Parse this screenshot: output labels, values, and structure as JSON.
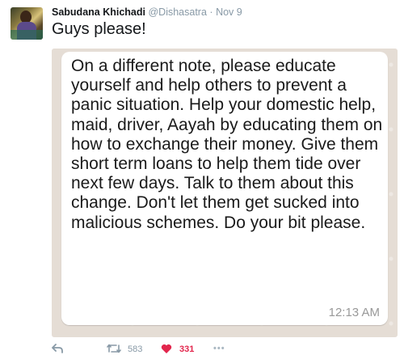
{
  "tweet": {
    "author_name": "Sabudana Khichadi",
    "handle": "@Dishasatra",
    "separator": "·",
    "date": "Nov 9",
    "text": "Guys please!",
    "avatar_icon": "profile-photo"
  },
  "screenshot": {
    "message_text": "On a different note, please educate yourself and help others to prevent a panic situation. Help your domestic help, maid, driver, Aayah by educating them on how to exchange their money. Give them short term loans to help them tide over next few days. Talk to them about this change. Don't let them get sucked into malicious schemes. Do your bit please.",
    "time": "12:13 AM",
    "bubble_color": "#ffffff",
    "chat_background": "#e5ddd5"
  },
  "actions": {
    "reply_icon": "reply-icon",
    "retweet_icon": "retweet-icon",
    "retweet_count": "583",
    "like_icon": "heart-icon",
    "like_count": "331",
    "like_color": "#e2264d",
    "more_label": "•••"
  }
}
